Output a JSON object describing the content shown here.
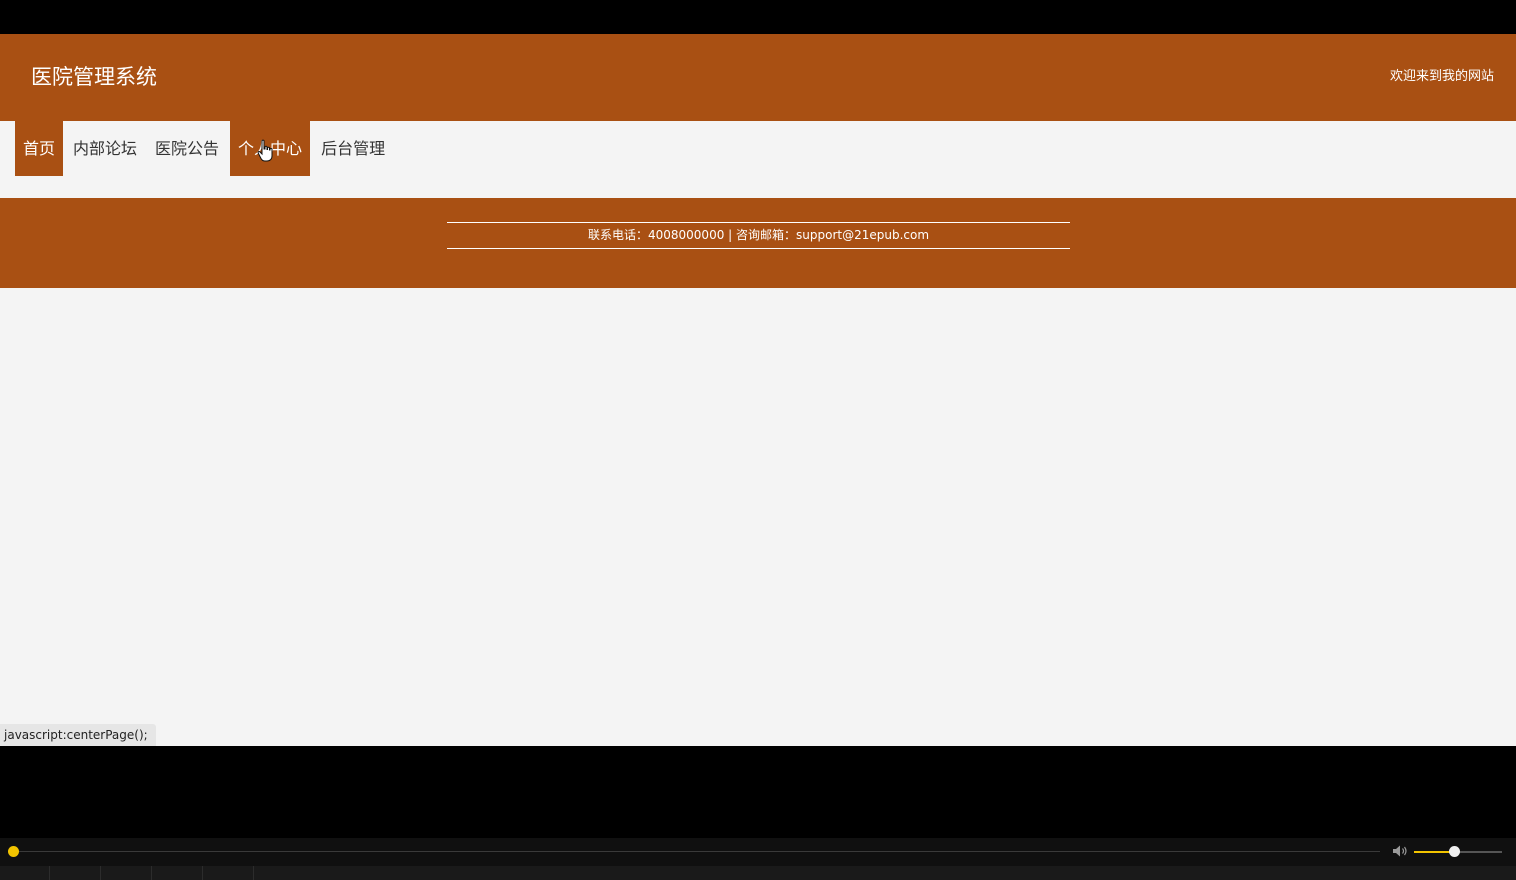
{
  "header": {
    "site_title": "医院管理系统",
    "welcome_text": "欢迎来到我的网站"
  },
  "nav": {
    "items": [
      {
        "label": "首页",
        "state": "active"
      },
      {
        "label": "内部论坛",
        "state": "normal"
      },
      {
        "label": "医院公告",
        "state": "normal"
      },
      {
        "label": "个人中心",
        "state": "hover"
      },
      {
        "label": "后台管理",
        "state": "normal"
      }
    ]
  },
  "footer": {
    "contact_text": "联系电话：4008000000 | 咨询邮箱：support@21epub.com"
  },
  "status_bar": {
    "link_url": "javascript:centerPage();"
  },
  "player": {
    "progress": 0.0,
    "volume": 0.45
  },
  "colors": {
    "brand": "#a95013",
    "page_background": "#f4f4f4",
    "player_accent": "#f2c400"
  },
  "icons": {
    "cursor": "hand-pointer-icon",
    "volume": "speaker-icon"
  }
}
